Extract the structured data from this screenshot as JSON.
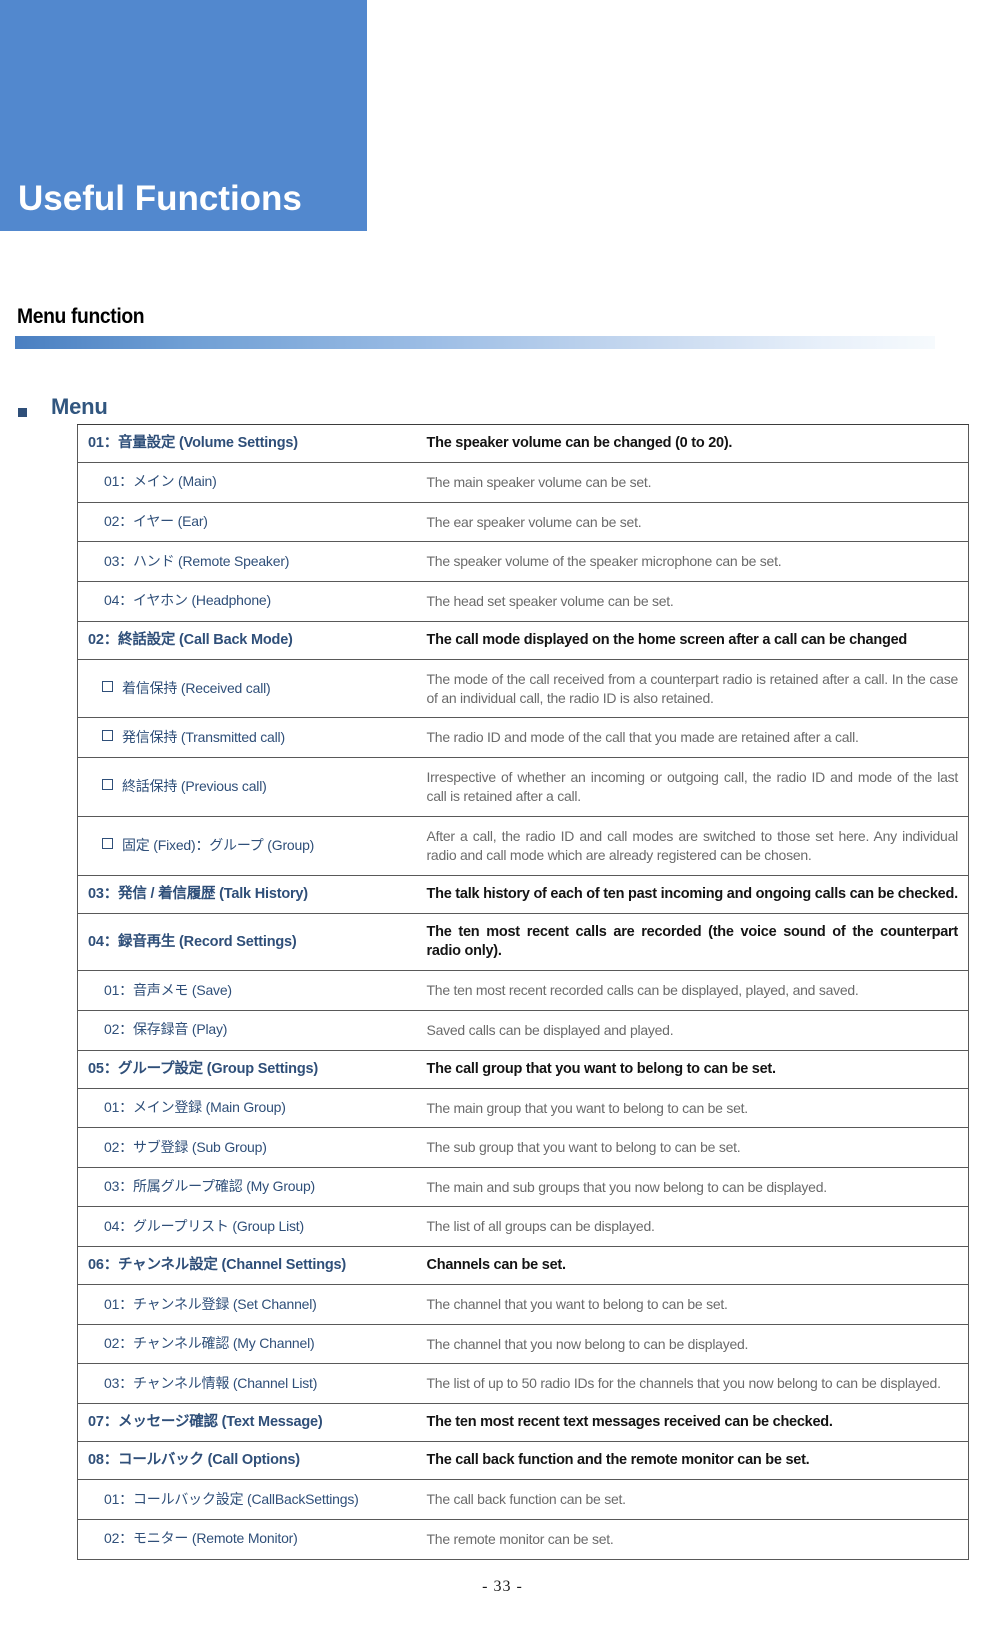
{
  "chapter": {
    "title": "Useful Functions",
    "banner_color": "#5288ce"
  },
  "section": {
    "heading": "Menu function",
    "rule_start_color": "#4a7fc1",
    "rule_end_color": "#f6fafd"
  },
  "menu_block": {
    "label": "Menu",
    "label_color": "#31567f",
    "bullet": "square-bullet-icon"
  },
  "table": {
    "rows": [
      {
        "level": "lvl1",
        "left": "01：音量設定  (Volume Settings)",
        "right": "The speaker volume can be changed (0 to 20)."
      },
      {
        "level": "lvl2",
        "left": "01：メイン  (Main)",
        "right": "The main speaker volume can be set."
      },
      {
        "level": "lvl2",
        "left": "02：イヤー  (Ear)",
        "right": "The ear speaker volume can be set."
      },
      {
        "level": "lvl2",
        "left": "03：ハンド  (Remote Speaker)",
        "right": "The speaker volume of the speaker microphone can be set."
      },
      {
        "level": "lvl2",
        "left": "04：イヤホン  (Headphone)",
        "right": "The head set speaker volume can be set."
      },
      {
        "level": "lvl1",
        "left": "02：終話設定  (Call Back Mode)",
        "right": "The call mode displayed on the home screen after a call can be changed"
      },
      {
        "level": "lvlc",
        "left": "着信保持  (Received call)",
        "right": "The mode of the call received from a counterpart radio is retained after a call. In the case of an individual call, the radio ID is also retained."
      },
      {
        "level": "lvlc",
        "left": "発信保持  (Transmitted call)",
        "right": "The radio ID and mode of the call that you made are retained after a call."
      },
      {
        "level": "lvlc",
        "left": "終話保持  (Previous call)",
        "right": "Irrespective of whether an incoming or outgoing call, the radio ID and mode of the last call is retained after a call."
      },
      {
        "level": "lvlc",
        "left": "固定  (Fixed)：グループ  (Group)",
        "right": "After a call, the radio ID and call modes are switched to those set here. Any individual radio and call mode which are already registered can be chosen."
      },
      {
        "level": "lvl1",
        "left": "03：発信 / 着信履歴  (Talk History)",
        "right": "The talk history of each of ten past incoming and ongoing calls can be checked."
      },
      {
        "level": "lvl1",
        "left": "04：録音再生  (Record Settings)",
        "right": "The ten most recent calls are recorded (the voice sound of the counterpart radio only)."
      },
      {
        "level": "lvl2",
        "left": "01：音声メモ  (Save)",
        "right": "The ten most recent recorded calls can be displayed, played, and saved."
      },
      {
        "level": "lvl2",
        "left": "02：保存録音  (Play)",
        "right": "Saved calls can be displayed and played."
      },
      {
        "level": "lvl1",
        "left": "05：グループ設定  (Group Settings)",
        "right": "The call group that you want to belong to can be set."
      },
      {
        "level": "lvl2",
        "left": "01：メイン登録  (Main Group)",
        "right": "The main group that you want to belong to can be set."
      },
      {
        "level": "lvl2",
        "left": "02：サブ登録  (Sub Group)",
        "right": "The sub group that you want to belong to can be set."
      },
      {
        "level": "lvl2",
        "left": "03：所属グループ確認  (My Group)",
        "right": "The main and sub groups that you now belong to can be displayed."
      },
      {
        "level": "lvl2",
        "left": "04：グループリスト  (Group List)",
        "right": "The list of all groups can be displayed."
      },
      {
        "level": "lvl1",
        "left": "06：チャンネル設定  (Channel Settings)",
        "right": "Channels can be set."
      },
      {
        "level": "lvl2",
        "left": "01：チャンネル登録  (Set Channel)",
        "right": "The channel that you want to belong to can be set."
      },
      {
        "level": "lvl2",
        "left": "02：チャンネル確認  (My Channel)",
        "right": "The channel that you now belong to can be displayed."
      },
      {
        "level": "lvl2",
        "left": "03：チャンネル情報  (Channel List)",
        "right": "The list of up to 50 radio IDs for the channels that you now belong to can be displayed."
      },
      {
        "level": "lvl1",
        "left": "07：メッセージ確認  (Text Message)",
        "right": "The ten most recent text messages received can be checked."
      },
      {
        "level": "lvl1",
        "left": "08：コールバック  (Call Options)",
        "right": "The call back function and the remote monitor can be set."
      },
      {
        "level": "lvl2",
        "left": "01：コールバック設定  (CallBackSettings)",
        "right": "The call back function can be set."
      },
      {
        "level": "lvl2",
        "left": "02：モニター  (Remote Monitor)",
        "right": "The remote monitor can be set."
      }
    ]
  },
  "footer": {
    "page_number": "- 33 -"
  }
}
